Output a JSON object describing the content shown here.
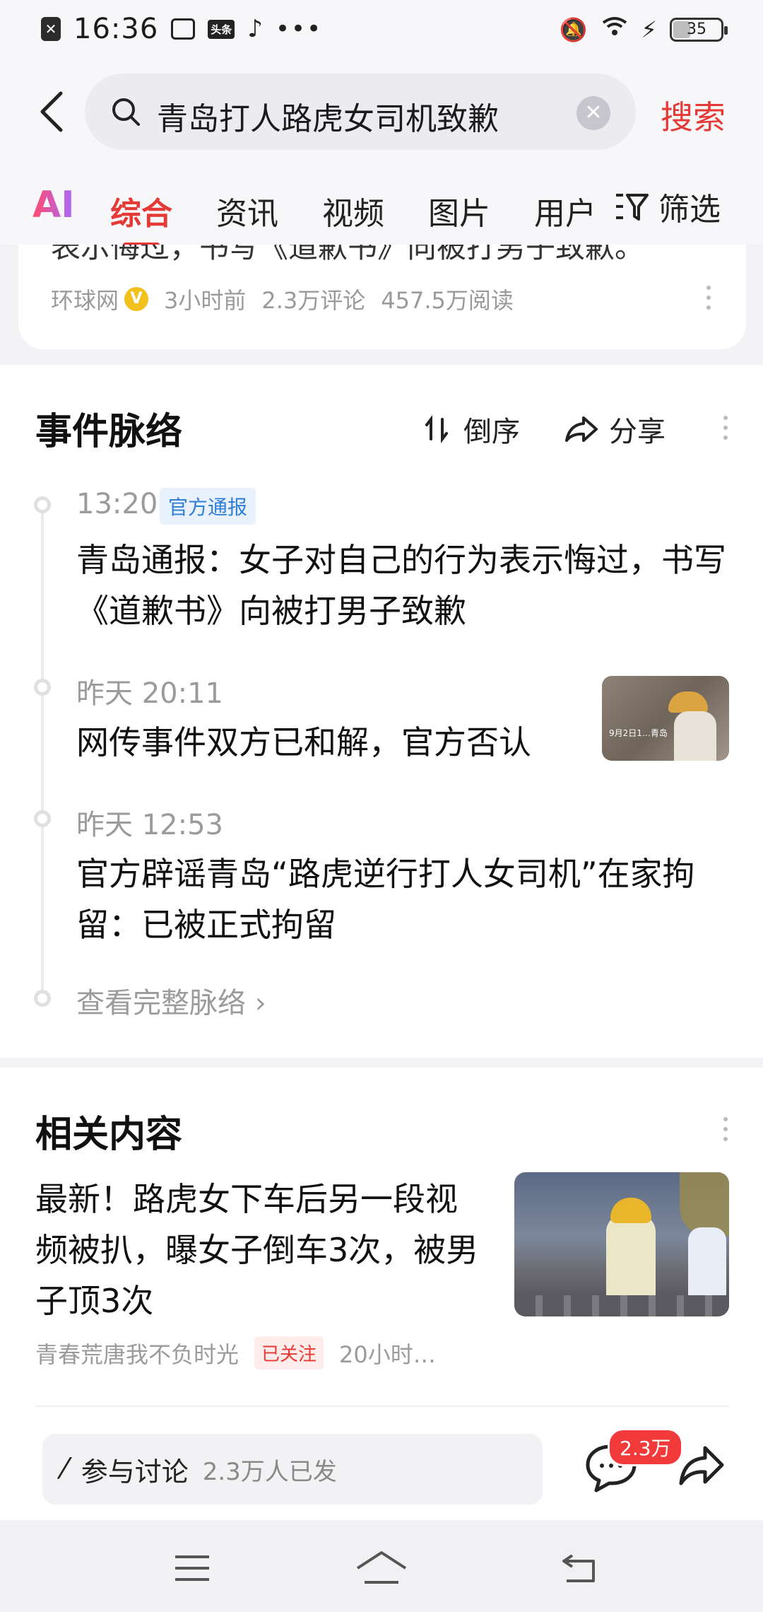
{
  "status_bar": {
    "time": "16:36",
    "app_badge": "头条",
    "battery": "35"
  },
  "search": {
    "query": "青岛打人路虎女司机致歉",
    "button_label": "搜索"
  },
  "tabs": {
    "ai": "AI",
    "items": [
      "综合",
      "资讯",
      "视频",
      "图片",
      "用户"
    ],
    "active": "综合",
    "filter_label": "筛选"
  },
  "top_card": {
    "cut_text": "表示悔过，书写《道歉书》向被打男子致歉。",
    "source": "环球网",
    "verified_badge": "V",
    "time": "3小时前",
    "comments": "2.3万评论",
    "reads": "457.5万阅读"
  },
  "timeline": {
    "title": "事件脉络",
    "sort_label": "倒序",
    "share_label": "分享",
    "events": [
      {
        "time": "13:20",
        "badge": "官方通报",
        "text": "青岛通报：女子对自己的行为表示悔过，书写《道歉书》向被打男子致歉"
      },
      {
        "time": "昨天 20:11",
        "text": "网传事件双方已和解，官方否认",
        "thumb_caption": "9月2日1…青岛"
      },
      {
        "time": "昨天 12:53",
        "text": "官方辟谣青岛“路虎逆行打人女司机”在家拘留：已被正式拘留"
      }
    ],
    "more_label": "查看完整脉络"
  },
  "related": {
    "title": "相关内容",
    "article": {
      "title": "最新！路虎女下车后另一段视频被扒，曝女子倒车3次，被男子顶3次",
      "author": "青春荒唐我不负时光",
      "follow_badge": "已关注",
      "time": "20小时…"
    }
  },
  "bottom_bar": {
    "discuss_label": "参与讨论",
    "discuss_count": "2.3万人已发",
    "comment_badge": "2.3万"
  },
  "colors": {
    "accent": "#e53935",
    "badge_blue": "#2f7fd6",
    "muted": "#9b9b9b"
  }
}
